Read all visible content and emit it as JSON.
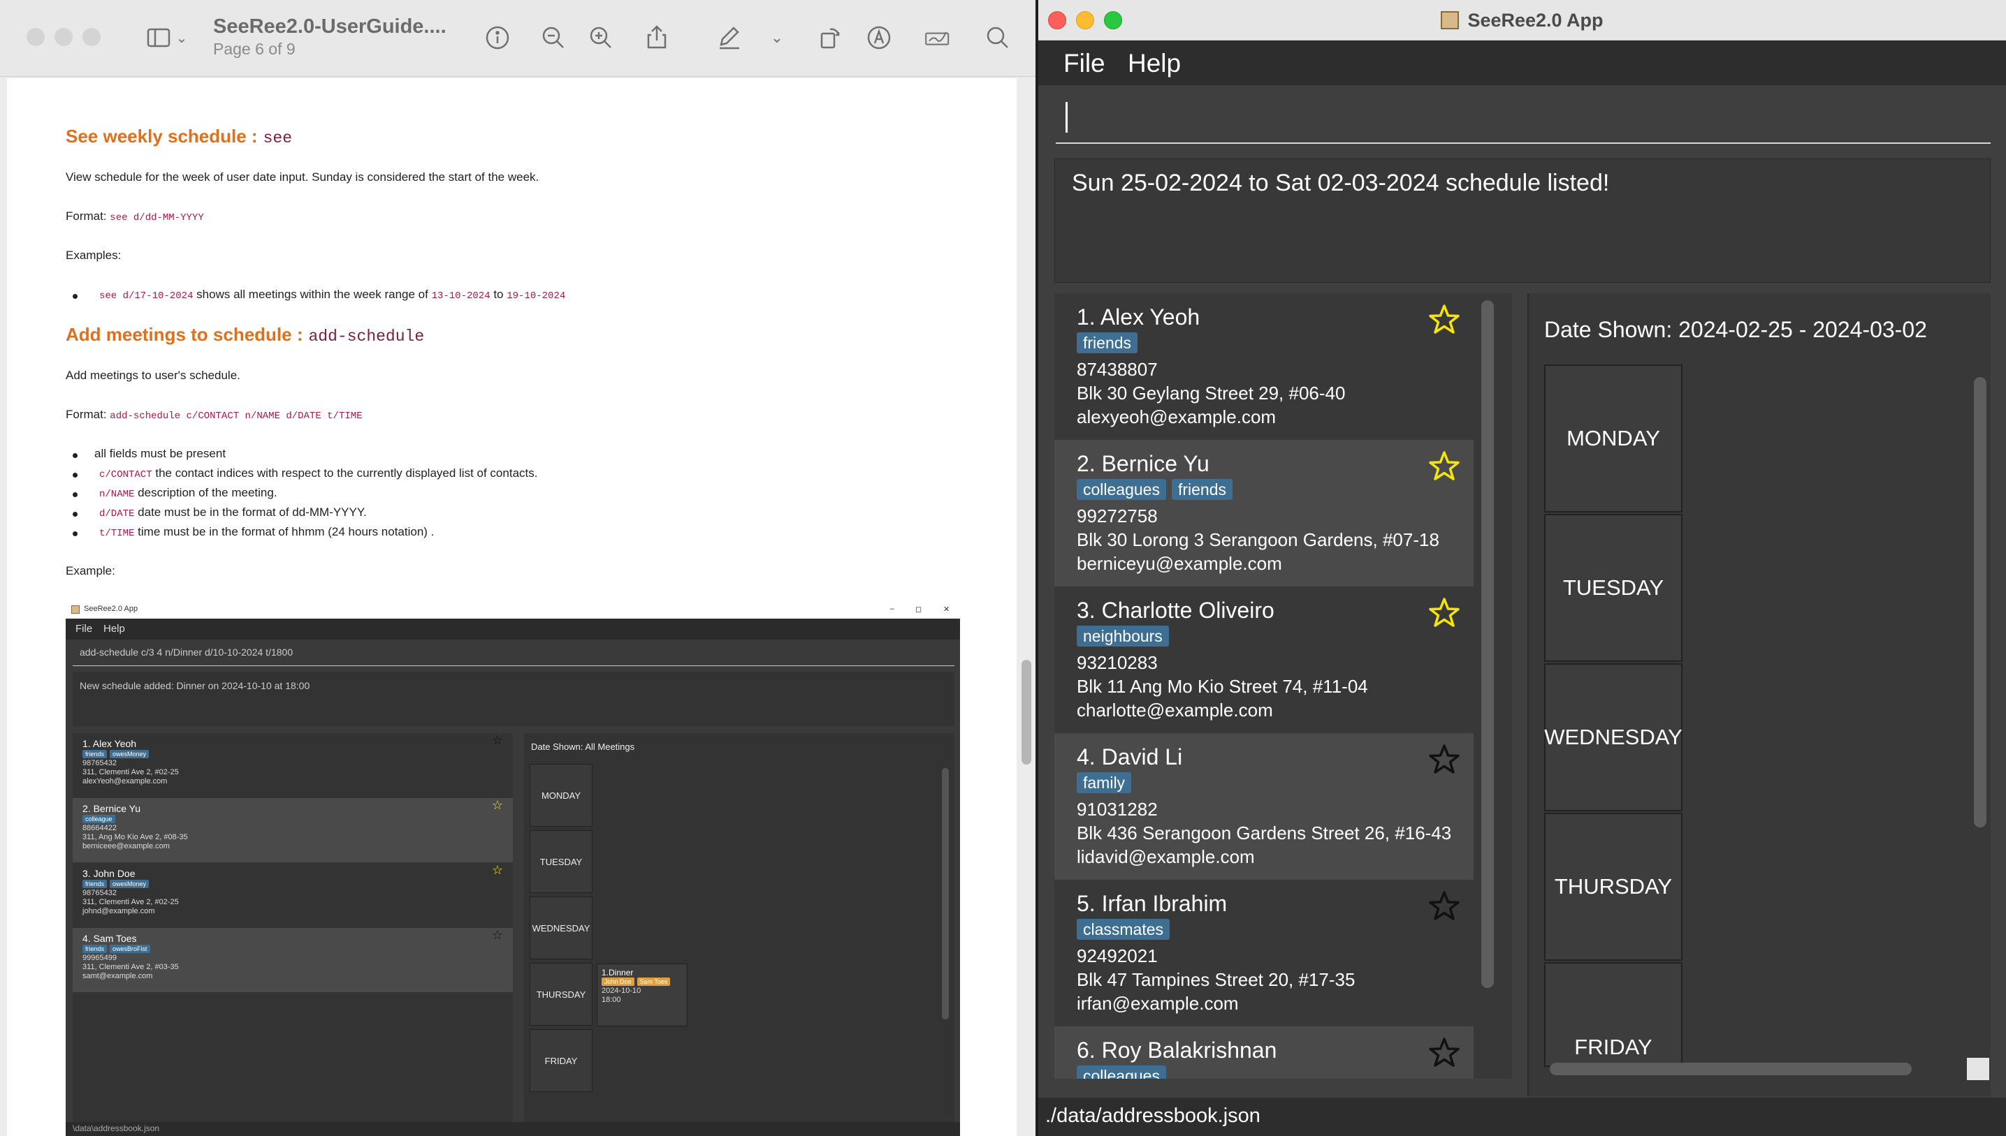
{
  "preview": {
    "doc_title": "SeeRee2.0-UserGuide....",
    "page_indicator": "Page 6 of 9",
    "sections": {
      "see": {
        "heading": "See weekly schedule :",
        "command": "see",
        "description": "View schedule for the week of user date input. Sunday is considered the start of the week.",
        "format_label": "Format:",
        "format_code": "see d/dd-MM-YYYY",
        "examples_label": "Examples:",
        "ex_code": "see d/17-10-2024",
        "ex_text1": "shows all meetings within the week range of",
        "ex_code2": "13-10-2024",
        "ex_to": "to",
        "ex_code3": "19-10-2024"
      },
      "add": {
        "heading": "Add meetings to schedule :",
        "command": "add-schedule",
        "description": "Add meetings to user's schedule.",
        "format_label": "Format:",
        "format_code": "add-schedule c/CONTACT n/NAME d/DATE t/TIME",
        "bullets": [
          {
            "code": "",
            "text": "all fields must be present"
          },
          {
            "code": "c/CONTACT",
            "text": "the contact indices with respect to the currently displayed list of contacts."
          },
          {
            "code": "n/NAME",
            "text": "description of the meeting."
          },
          {
            "code": "d/DATE",
            "text": "date must be in the format of dd-MM-YYYY."
          },
          {
            "code": "t/TIME",
            "text": "time must be in the format of hhmm (24 hours notation) ."
          }
        ],
        "example_label": "Example:"
      }
    },
    "shot": {
      "title": "SeeRee2.0 App",
      "win_min": "–",
      "win_max": "◻",
      "win_close": "✕",
      "menu_file": "File",
      "menu_help": "Help",
      "command": "add-schedule c/3 4 n/Dinner d/10-10-2024 t/1800",
      "result": "New schedule added: Dinner on 2024-10-10 at 18:00",
      "contacts": [
        {
          "name": "1. Alex Yeoh",
          "tags": [
            "friends",
            "owesMoney"
          ],
          "phone": "98765432",
          "address": "311, Clementi Ave 2, #02-25",
          "email": "alexYeoh@example.com",
          "star": "☆"
        },
        {
          "name": "2. Bernice Yu",
          "tags": [
            "colleague"
          ],
          "phone": "88664422",
          "address": "311, Ang Mo Kio Ave 2, #08-35",
          "email": "berniceee@example.com",
          "star": "☆"
        },
        {
          "name": "3. John Doe",
          "tags": [
            "friends",
            "owesMoney"
          ],
          "phone": "98765432",
          "address": "311, Clementi Ave 2, #02-25",
          "email": "johnd@example.com",
          "star": "☆"
        },
        {
          "name": "4. Sam Toes",
          "tags": [
            "friends",
            "owesBroFist"
          ],
          "phone": "99965499",
          "address": "311, Clementi Ave 2, #03-35",
          "email": "samt@example.com",
          "star": "☆"
        }
      ],
      "date_shown": "Date Shown: All Meetings",
      "days": [
        "MONDAY",
        "TUESDAY",
        "WEDNESDAY",
        "THURSDAY",
        "FRIDAY"
      ],
      "meeting": {
        "title": "1.Dinner",
        "people": [
          "John Doe",
          "Sam Toes"
        ],
        "date": "2024-10-10",
        "time": "18:00"
      },
      "status": "\\data\\addressbook.json"
    }
  },
  "app": {
    "title": "SeeRee2.0 App",
    "menu": {
      "file": "File",
      "help": "Help"
    },
    "command_value": "",
    "result": "Sun 25-02-2024 to Sat 02-03-2024 schedule listed!",
    "persons": [
      {
        "name": "1. Alex Yeoh",
        "tags": [
          "friends"
        ],
        "phone": "87438807",
        "address": "Blk 30 Geylang Street 29, #06-40",
        "email": "alexyeoh@example.com",
        "favourite": true
      },
      {
        "name": "2. Bernice Yu",
        "tags": [
          "colleagues",
          "friends"
        ],
        "phone": "99272758",
        "address": "Blk 30 Lorong 3 Serangoon Gardens, #07-18",
        "email": "berniceyu@example.com",
        "favourite": true
      },
      {
        "name": "3. Charlotte Oliveiro",
        "tags": [
          "neighbours"
        ],
        "phone": "93210283",
        "address": "Blk 11 Ang Mo Kio Street 74, #11-04",
        "email": "charlotte@example.com",
        "favourite": true
      },
      {
        "name": "4. David Li",
        "tags": [
          "family"
        ],
        "phone": "91031282",
        "address": "Blk 436 Serangoon Gardens Street 26, #16-43",
        "email": "lidavid@example.com",
        "favourite": false
      },
      {
        "name": "5. Irfan Ibrahim",
        "tags": [
          "classmates"
        ],
        "phone": "92492021",
        "address": "Blk 47 Tampines Street 20, #17-35",
        "email": "irfan@example.com",
        "favourite": false
      },
      {
        "name": "6. Roy Balakrishnan",
        "tags": [
          "colleagues"
        ],
        "phone": "",
        "address": "",
        "email": "",
        "favourite": false
      }
    ],
    "date_shown": "Date Shown: 2024-02-25 - 2024-03-02",
    "days": [
      "MONDAY",
      "TUESDAY",
      "WEDNESDAY",
      "THURSDAY",
      "FRIDAY"
    ],
    "status": "./data/addressbook.json"
  },
  "colors": {
    "favourite_star": "#f5e50b",
    "tag": "#3e6f93",
    "heading": "#e0701a",
    "code": "#a8184b"
  }
}
